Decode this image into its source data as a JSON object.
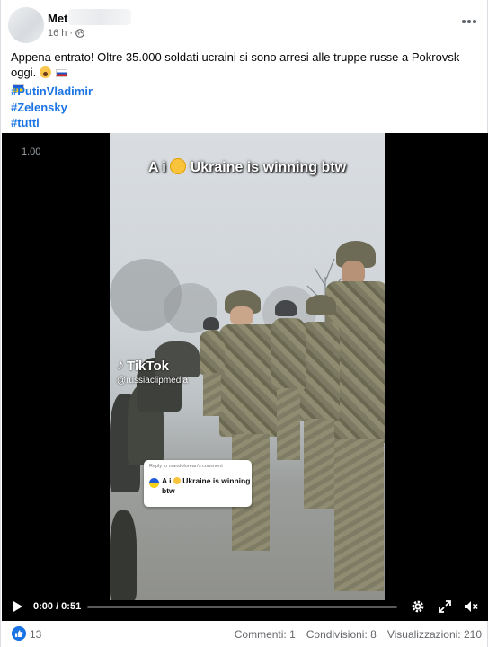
{
  "post": {
    "author": "Met",
    "time": "16 h",
    "text": "Appena entrato! Oltre 35.000 soldati ucraini si sono arresi alle truppe russe a Pokrovsk oggi.",
    "emojis": [
      "scream-emoji",
      "russia-flag",
      "ukraine-flag"
    ],
    "hashtags": [
      "#PutinVladimir",
      "#Zelensky",
      "#tutti"
    ]
  },
  "video": {
    "speed": "1.00",
    "caption_before": "A i",
    "caption_after": "Ukraine is winning btw",
    "tiktok_label": "TikTok",
    "tiktok_handle": "@russiaclipmedia",
    "reply_header": "Reply to mandolorean's comment",
    "reply_text_before": "A i",
    "reply_text_after": "Ukraine is winning btw",
    "time_display": "0:00 / 0:51",
    "progress": 0.0
  },
  "footer": {
    "likes": "13",
    "comments": "Commenti: 1",
    "shares": "Condivisioni: 8",
    "views": "Visualizzazioni: 210"
  },
  "colors": {
    "link": "#1b74e4",
    "muted": "#65676b"
  }
}
